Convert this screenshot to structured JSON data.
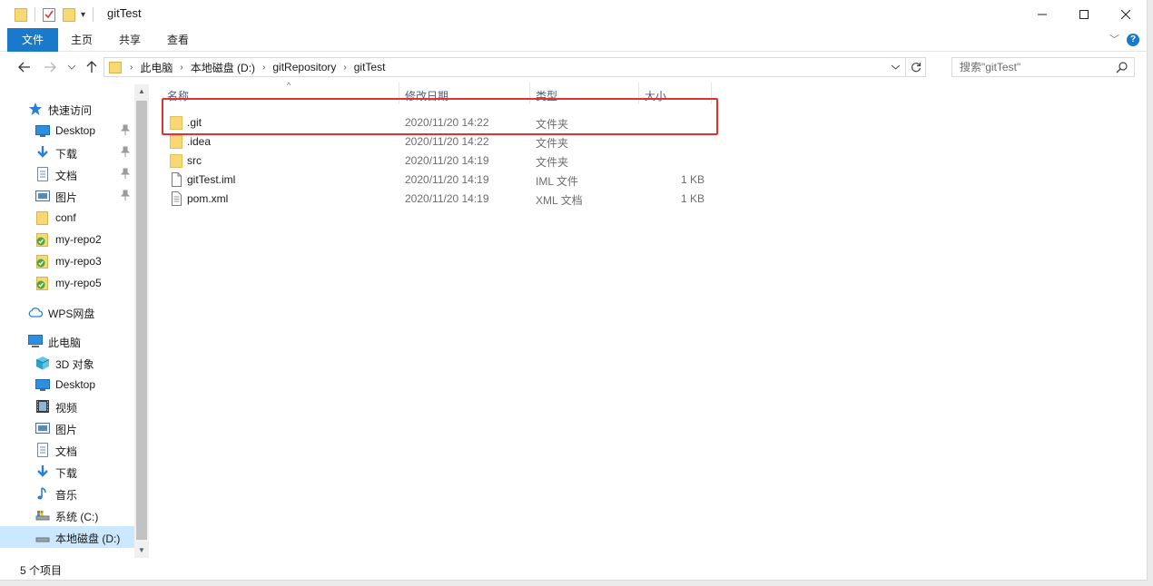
{
  "window": {
    "title": "gitTest",
    "controls": {
      "minimize": "─",
      "maximize": "☐",
      "close": "✕"
    }
  },
  "ribbon": {
    "tabs": [
      "文件",
      "主页",
      "共享",
      "查看"
    ],
    "help": "?"
  },
  "address": {
    "crumbs": [
      "此电脑",
      "本地磁盘 (D:)",
      "gitRepository",
      "gitTest"
    ]
  },
  "search": {
    "placeholder": "搜索\"gitTest\""
  },
  "sidebar": {
    "items": [
      {
        "label": "快速访问",
        "icon": "star-icon"
      },
      {
        "label": "Desktop",
        "icon": "desktop-icon",
        "pinned": true
      },
      {
        "label": "下载",
        "icon": "download-arrow-icon",
        "pinned": true
      },
      {
        "label": "文档",
        "icon": "document-icon",
        "pinned": true
      },
      {
        "label": "图片",
        "icon": "picture-icon",
        "pinned": true
      },
      {
        "label": "conf",
        "icon": "folder-icon"
      },
      {
        "label": "my-repo2",
        "icon": "git-folder-icon"
      },
      {
        "label": "my-repo3",
        "icon": "git-folder-icon"
      },
      {
        "label": "my-repo5",
        "icon": "git-folder-icon"
      },
      {
        "label": "WPS网盘",
        "icon": "cloud-icon"
      },
      {
        "label": "此电脑",
        "icon": "computer-icon"
      },
      {
        "label": "3D 对象",
        "icon": "cube-icon"
      },
      {
        "label": "Desktop",
        "icon": "desktop-icon"
      },
      {
        "label": "视频",
        "icon": "video-icon"
      },
      {
        "label": "图片",
        "icon": "picture-icon"
      },
      {
        "label": "文档",
        "icon": "document-icon"
      },
      {
        "label": "下载",
        "icon": "download-arrow-icon"
      },
      {
        "label": "音乐",
        "icon": "music-note-icon"
      },
      {
        "label": "系统 (C:)",
        "icon": "drive-icon"
      },
      {
        "label": "本地磁盘 (D:)",
        "icon": "drive-icon",
        "selected": true
      }
    ]
  },
  "columns": {
    "name": "名称",
    "date": "修改日期",
    "type": "类型",
    "size": "大小"
  },
  "files": [
    {
      "name": ".git",
      "date": "2020/11/20 14:22",
      "type": "文件夹",
      "size": "",
      "icon": "folder-icon"
    },
    {
      "name": ".idea",
      "date": "2020/11/20 14:22",
      "type": "文件夹",
      "size": "",
      "icon": "folder-icon"
    },
    {
      "name": "src",
      "date": "2020/11/20 14:19",
      "type": "文件夹",
      "size": "",
      "icon": "folder-icon"
    },
    {
      "name": "gitTest.iml",
      "date": "2020/11/20 14:19",
      "type": "IML 文件",
      "size": "1 KB",
      "icon": "file-icon"
    },
    {
      "name": "pom.xml",
      "date": "2020/11/20 14:19",
      "type": "XML 文档",
      "size": "1 KB",
      "icon": "file-icon"
    }
  ],
  "status": {
    "item_count": "5 个项目"
  },
  "colors": {
    "accent": "#1979ca",
    "highlight_box": "#e5312d",
    "folder": "#f8d775",
    "selected": "#cce8ff"
  }
}
